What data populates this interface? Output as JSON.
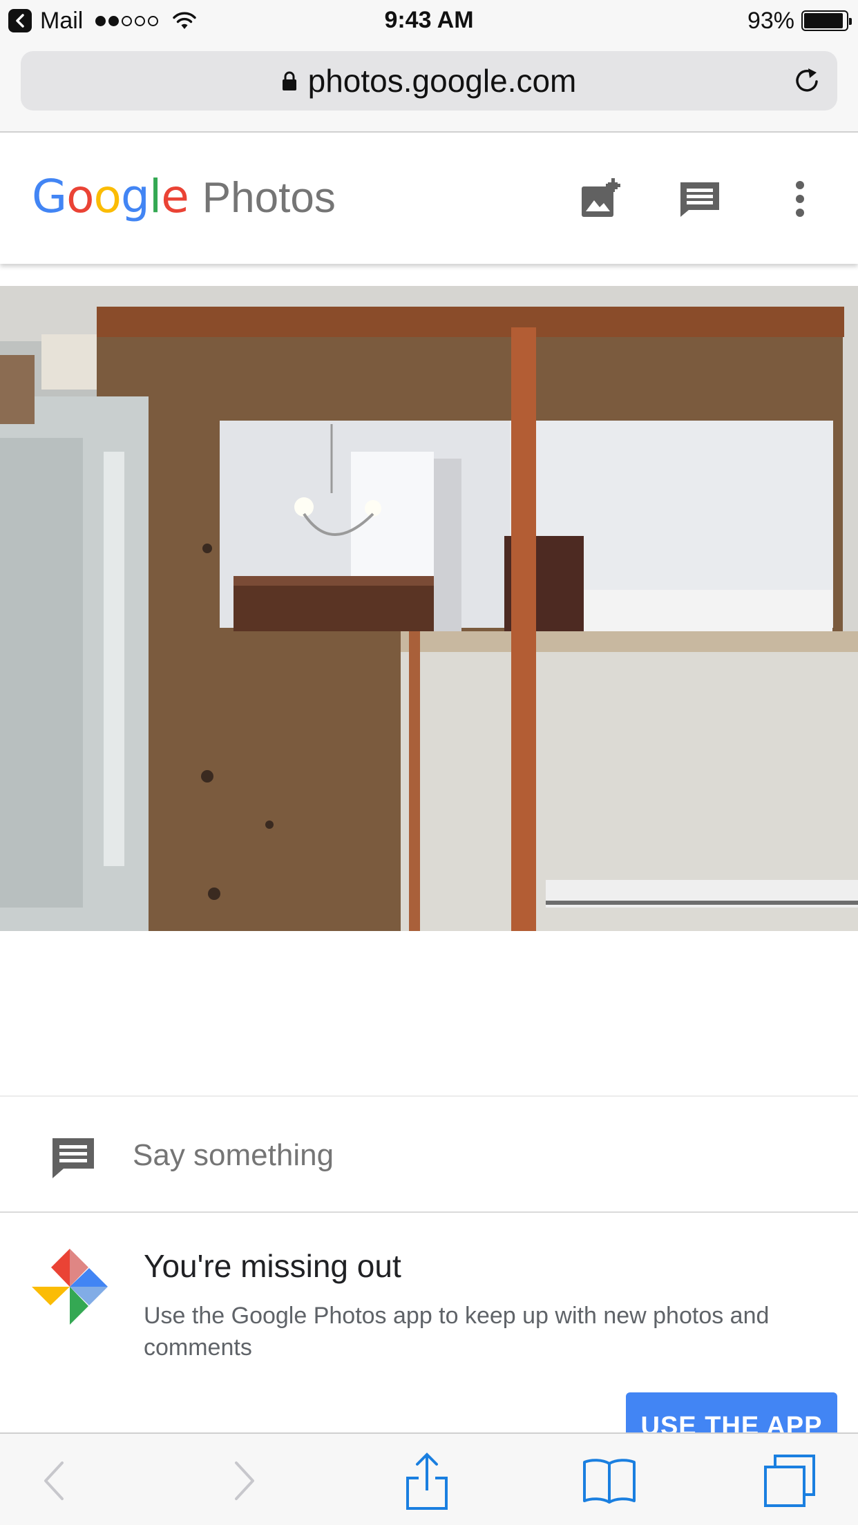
{
  "status_bar": {
    "back_app": "Mail",
    "time": "9:43 AM",
    "battery_percent": "93%",
    "battery_level": 0.93,
    "signal_bars_filled": 2,
    "signal_bars_total": 5
  },
  "browser": {
    "url": "photos.google.com",
    "icons": {
      "lock": "lock-icon",
      "reload": "reload-icon"
    }
  },
  "header": {
    "logo_letters": [
      {
        "ch": "G",
        "color": "#4285F4"
      },
      {
        "ch": "o",
        "color": "#EA4335"
      },
      {
        "ch": "o",
        "color": "#FBBC05"
      },
      {
        "ch": "g",
        "color": "#4285F4"
      },
      {
        "ch": "l",
        "color": "#34A853"
      },
      {
        "ch": "e",
        "color": "#EA4335"
      }
    ],
    "logo_product": "Photos",
    "icons": [
      "add-photo-icon",
      "comment-icon",
      "more-vert-icon"
    ]
  },
  "comment": {
    "placeholder": "Say something",
    "icon": "comment-icon"
  },
  "promo": {
    "title": "You're missing out",
    "body": "Use the Google Photos app to keep up with new photos and comments",
    "button": "USE THE APP",
    "icon": "google-photos-pinwheel-icon"
  },
  "toolbar": {
    "icons": [
      "back-arrow-icon",
      "forward-arrow-icon",
      "share-icon",
      "bookmarks-icon",
      "tabs-icon"
    ]
  },
  "colors": {
    "accent_blue": "#4285F4",
    "ios_blue": "#1A7FE0",
    "ios_disabled": "#C7C7CC",
    "icon_gray": "#616161"
  }
}
